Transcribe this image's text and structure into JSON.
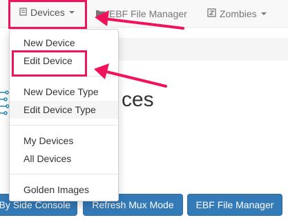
{
  "navbar": {
    "devices_label": "Devices",
    "ebf_label": "EBF File Manager",
    "zombies_label": "Zombies"
  },
  "dropdown": {
    "items": [
      {
        "label": "New Device"
      },
      {
        "label": "Edit Device"
      },
      {
        "label": "New Device Type"
      },
      {
        "label": "Edit Device Type"
      },
      {
        "label": "My Devices"
      },
      {
        "label": "All Devices"
      },
      {
        "label": "Golden Images"
      }
    ]
  },
  "main": {
    "heading_visible": "ces"
  },
  "buttons": {
    "console_label": "By Side Console",
    "refresh_label": "Refresh Mux Mode",
    "ebf_label": "EBF File Manager"
  },
  "colors": {
    "annotation": "#f0135a",
    "primary_button": "#337ab7"
  },
  "icons": {
    "devices": "server-icon",
    "ebf": "folder-icon",
    "zombies": "zombie-icon"
  }
}
